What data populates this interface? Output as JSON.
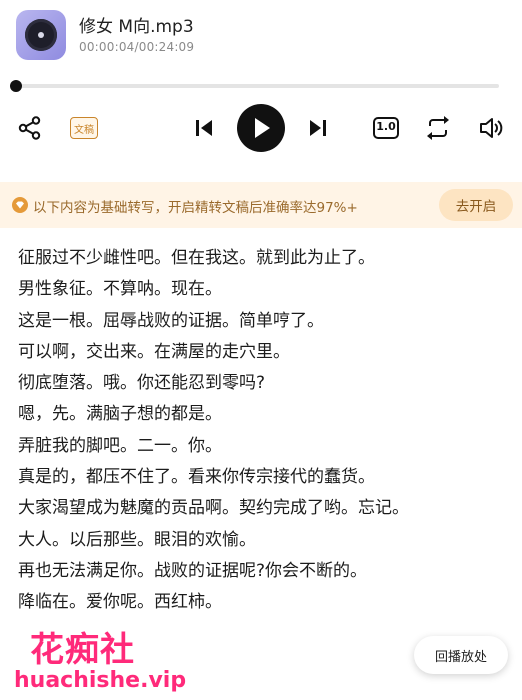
{
  "player": {
    "title": "修女 M向.mp3",
    "time": "00:00:04/00:24:09",
    "progress_fraction": 0.003
  },
  "controls": {
    "wengao_label": "文稿",
    "speed_label": "1.0"
  },
  "notice": {
    "text": "以下内容为基础转写，开启精转文稿后准确率达97%+",
    "button_label": "去开启"
  },
  "transcript": {
    "lines": [
      "征服过不少雌性吧。但在我这。就到此为止了。",
      "男性象征。不算呐。现在。",
      "这是一根。屈辱战败的证据。简单哼了。",
      "可以啊，交出来。在满屋的走穴里。",
      "彻底堕落。哦。你还能忍到零吗?",
      "嗯，先。满脑子想的都是。",
      "弄脏我的脚吧。二一。你。",
      "真是的，都压不住了。看来你传宗接代的蠢货。",
      "大家渴望成为魅魔的贡品啊。契约完成了哟。忘记。",
      "大人。以后那些。眼泪的欢愉。",
      "再也无法满足你。战败的证据呢?你会不断的。",
      "降临在。爱你呢。西红柿。"
    ]
  },
  "replay": {
    "label": "回播放处"
  },
  "watermark": {
    "cn": "花痴社",
    "url": "huachishe.vip"
  },
  "colors": {
    "accent": "#111111",
    "notice_bg": "#fff4e6",
    "notice_text": "#9a6a2c",
    "watermark": "#ff2a7a"
  }
}
